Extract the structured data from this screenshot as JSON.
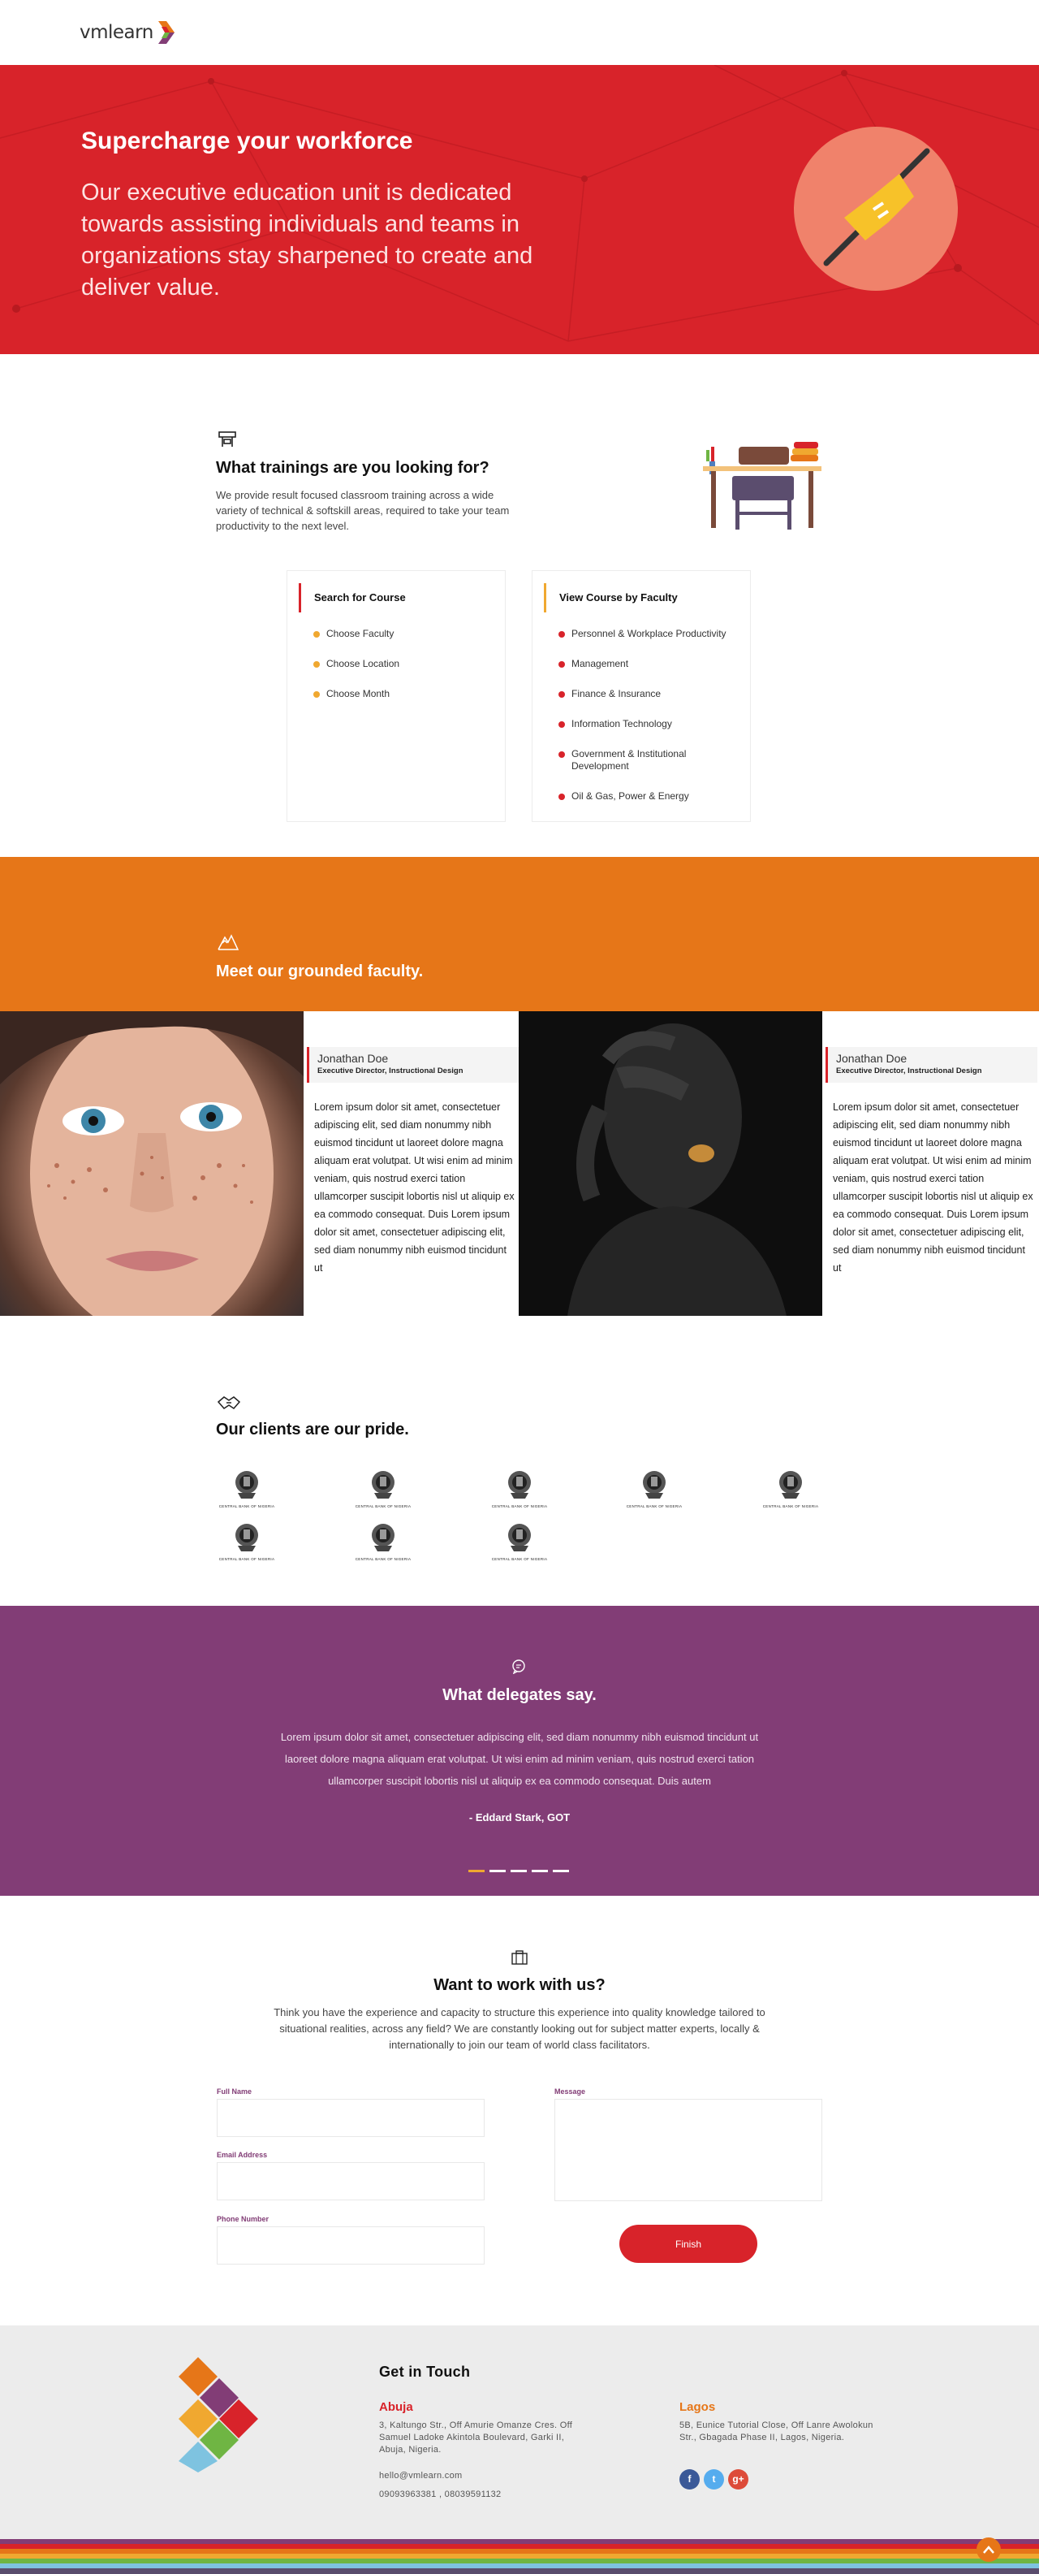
{
  "header": {
    "logo_text": "vmlearn"
  },
  "hero": {
    "title": "Supercharge your workforce",
    "text": "Our executive education unit is dedicated towards assisting individuals and teams in organizations stay sharpened to create and deliver value."
  },
  "trainings": {
    "title": "What trainings are you looking for?",
    "description": "We provide result focused classroom training across a wide variety of technical & softskill areas, required to take your team productivity to the next level.",
    "search_card": {
      "title": "Search for Course",
      "items": [
        "Choose Faculty",
        "Choose Location",
        "Choose Month"
      ]
    },
    "faculty_card": {
      "title": "View Course by Faculty",
      "items": [
        "Personnel & Workplace Productivity",
        "Management",
        "Finance & Insurance",
        "Information Technology",
        "Government & Institutional Development",
        "Oil & Gas, Power & Energy"
      ]
    }
  },
  "faculty": {
    "title": "Meet our grounded faculty.",
    "members": [
      {
        "name": "Jonathan Doe",
        "role": "Executive Director, Instructional Design",
        "bio": "Lorem ipsum dolor sit amet, consectetuer adipiscing elit, sed diam nonummy nibh euismod tincidunt ut laoreet dolore magna aliquam erat volutpat. Ut wisi enim ad minim veniam, quis nostrud exerci tation ullamcorper suscipit lobortis nisl ut aliquip ex ea commodo consequat. Duis Lorem ipsum dolor sit amet, consectetuer adipiscing elit, sed diam nonummy nibh euismod tincidunt ut"
      },
      {
        "name": "Jonathan Doe",
        "role": "Executive Director, Instructional Design",
        "bio": "Lorem ipsum dolor sit amet, consectetuer adipiscing elit, sed diam nonummy nibh euismod tincidunt ut laoreet dolore magna aliquam erat volutpat. Ut wisi enim ad minim veniam, quis nostrud exerci tation ullamcorper suscipit lobortis nisl ut aliquip ex ea commodo consequat. Duis Lorem ipsum dolor sit amet, consectetuer adipiscing elit, sed diam nonummy nibh euismod tincidunt ut"
      }
    ]
  },
  "clients": {
    "title": "Our clients are our pride.",
    "logo_caption": "CENTRAL BANK OF NIGERIA",
    "count": 8
  },
  "delegates": {
    "title": "What delegates say.",
    "quote": "Lorem ipsum dolor sit amet, consectetuer adipiscing elit, sed diam nonummy nibh euismod tincidunt ut laoreet dolore magna aliquam erat volutpat. Ut wisi enim ad minim veniam, quis nostrud exerci tation ullamcorper suscipit lobortis nisl ut aliquip ex ea commodo consequat. Duis autem",
    "author": "- Eddard Stark, GOT",
    "slides": 5,
    "active_slide": 0
  },
  "work": {
    "title": "Want to work with us?",
    "description": "Think you have the experience and capacity to structure this experience into quality knowledge tailored to situational realities, across any field? We are constantly looking out for subject matter experts, locally & internationally to join our team of world class facilitators.",
    "labels": {
      "full_name": "Full Name",
      "email": "Email Address",
      "phone": "Phone Number",
      "message": "Message"
    },
    "submit": "Finish"
  },
  "footer": {
    "title": "Get in Touch",
    "abuja": {
      "city": "Abuja",
      "address": "3, Kaltungo Str., Off Amurie Omanze Cres. Off Samuel Ladoke Akintola Boulevard, Garki II, Abuja, Nigeria."
    },
    "lagos": {
      "city": "Lagos",
      "address": "5B, Eunice Tutorial Close, Off Lanre Awolokun Str., Gbagada Phase II, Lagos, Nigeria."
    },
    "email": "hello@vmlearn.com",
    "phones": "09093963381 , 08039591132",
    "social": [
      {
        "name": "facebook-icon",
        "glyph": "f",
        "color": "#3b5998"
      },
      {
        "name": "twitter-icon",
        "glyph": "t",
        "color": "#55acee"
      },
      {
        "name": "google-plus-icon",
        "glyph": "g+",
        "color": "#dd4b39"
      }
    ]
  },
  "colors": {
    "brand_red": "#d8232a",
    "brand_orange": "#e67618",
    "brand_purple": "#823d76",
    "accent_yellow": "#f0a830"
  }
}
